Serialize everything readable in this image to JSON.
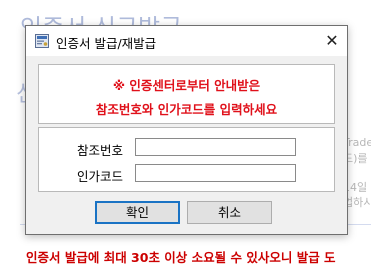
{
  "background": {
    "heading": "인증서 신규발급",
    "side_text": "신",
    "right_texts": [
      "Trade",
      "드)를",
      "",
      "14일",
      "업하시"
    ],
    "notice": "인증서 발급에 최대 30초 이상 소요될 수 있사오니 발급 도"
  },
  "dialog": {
    "title": "인증서 발급/재발급",
    "close_glyph": "✕",
    "message_line1": "※ 인증센터로부터 안내받은",
    "message_line2": "참조번호와 인가코드를 입력하세요",
    "ref_label": "참조번호",
    "ref_value": "",
    "auth_label": "인가코드",
    "auth_value": "",
    "ok_label": "확인",
    "cancel_label": "취소"
  },
  "colors": {
    "message_red": "#e0101a",
    "notice_red": "#cc0000",
    "ok_focus_border": "#1a73c4",
    "dialog_bg": "#f0f0f0"
  },
  "icons": {
    "title_icon": "certificate-window-icon",
    "close_icon": "close-icon"
  }
}
